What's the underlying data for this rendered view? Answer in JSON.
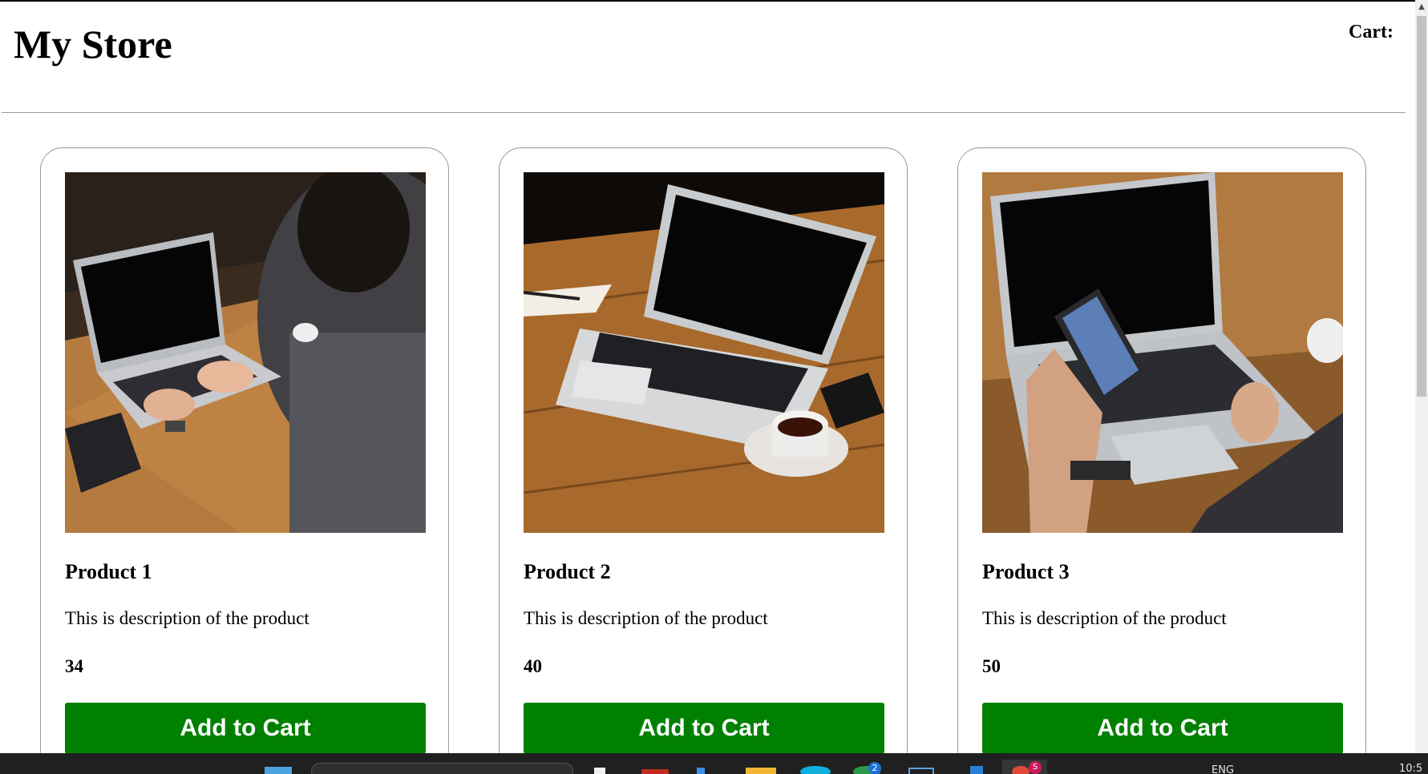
{
  "header": {
    "title": "My Store",
    "cart_label": "Cart:"
  },
  "products": [
    {
      "name": "Product 1",
      "description": "This is description of the product",
      "price": "34",
      "button_label": "Add to Cart",
      "image": "person-typing-on-laptop-photo"
    },
    {
      "name": "Product 2",
      "description": "This is description of the product",
      "price": "40",
      "button_label": "Add to Cart",
      "image": "laptop-on-wooden-table-with-coffee-photo"
    },
    {
      "name": "Product 3",
      "description": "This is description of the product",
      "price": "50",
      "button_label": "Add to Cart",
      "image": "hand-holding-phone-over-laptop-photo"
    }
  ],
  "taskbar": {
    "language": "ENG",
    "clock": "10:5",
    "badges": [
      "2",
      "S"
    ],
    "icons": [
      "start-icon",
      "search-box",
      "file-icon",
      "mail-icon",
      "edge-icon",
      "folder-icon",
      "skype-icon",
      "chrome-icon",
      "window-icon",
      "vscode-icon",
      "browser-icon"
    ]
  },
  "colors": {
    "button_bg": "#008000",
    "button_text": "#ffffff",
    "card_border": "#999999",
    "taskbar_bg": "#202020"
  }
}
